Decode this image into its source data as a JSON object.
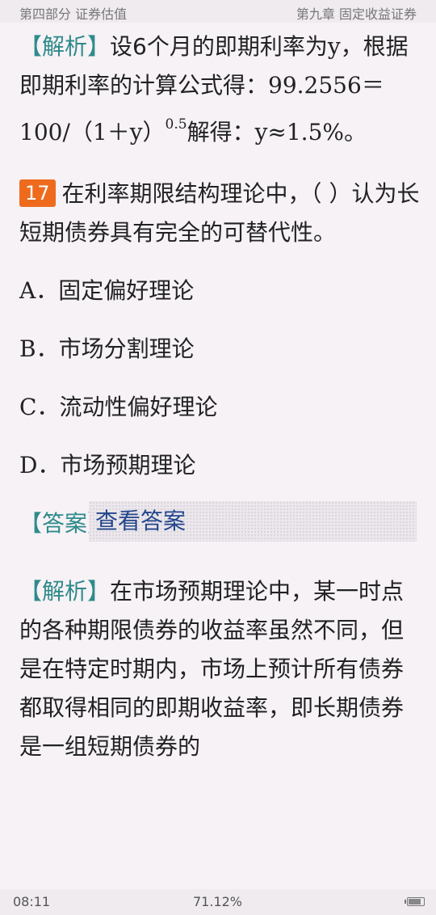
{
  "header": {
    "left": "第四部分 证券估值",
    "right": "第九章 固定收益证券"
  },
  "prev_analysis": {
    "tag": "【解析】",
    "part1": "设6个月的即期利率为",
    "var1": "y",
    "part2": "，根据即期利率的计算公式得：",
    "n1": "99.2556",
    "n2": "＝100/（1＋y）",
    "exp": "0.5",
    "part3": "解得：",
    "n3": "y≈1.5%",
    "end": "。"
  },
  "question": {
    "number": "17",
    "text": "在利率期限结构理论中，（ ）认为长短期债券具有完全的可替代性。"
  },
  "options": [
    {
      "letter": "A",
      "text": "．固定偏好理论"
    },
    {
      "letter": "B",
      "text": "．市场分割理论"
    },
    {
      "letter": "C",
      "text": "．流动性偏好理论"
    },
    {
      "letter": "D",
      "text": "．市场预期理论"
    }
  ],
  "answer": {
    "tag": "【答案】",
    "button": "查看答案"
  },
  "analysis": {
    "tag": "【解析】",
    "text": "在市场预期理论中，某一时点的各种期限债券的收益率虽然不同，但是在特定时期内，市场上预计所有债券都取得相同的即期收益率，即长期债券是一组短期债券的"
  },
  "footer": {
    "time": "08:11",
    "progress": "71.12%",
    "battery_level": 0.85
  }
}
